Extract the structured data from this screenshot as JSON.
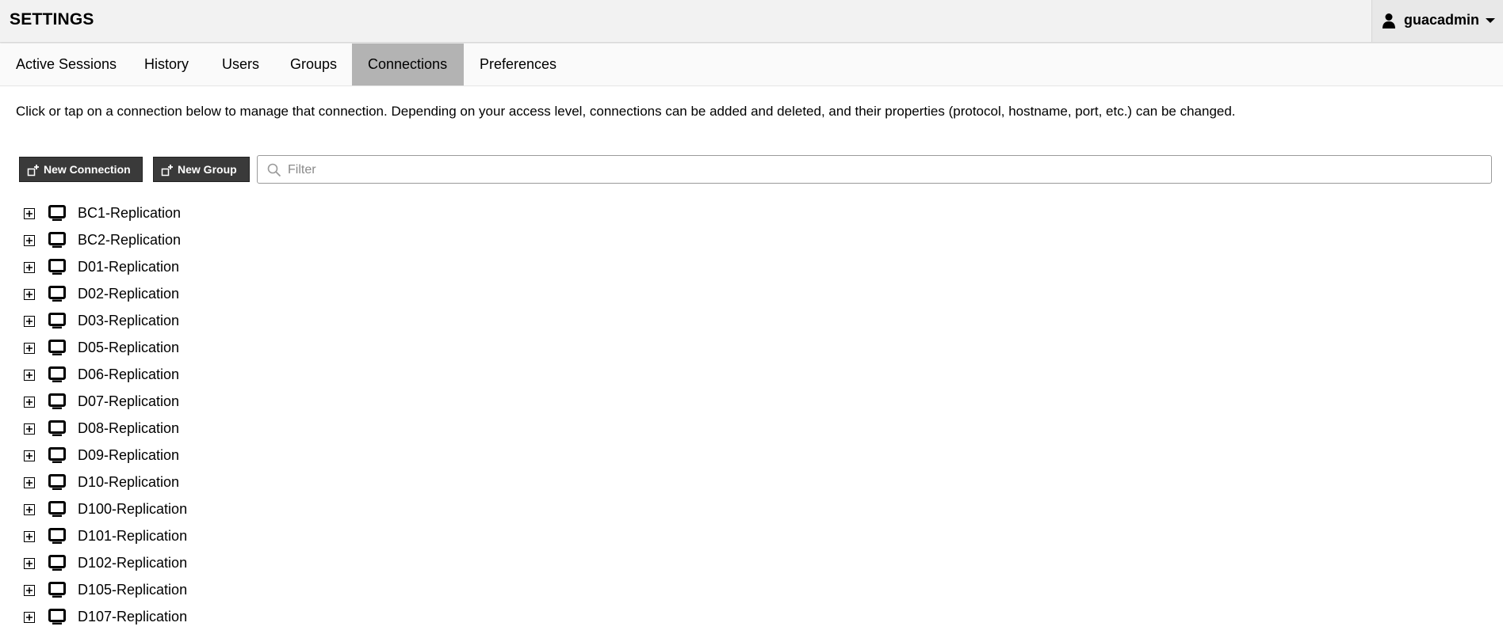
{
  "header": {
    "title": "SETTINGS",
    "user": {
      "name": "guacadmin",
      "icon": "user-icon"
    }
  },
  "tabs": [
    {
      "label": "Active Sessions",
      "active": false
    },
    {
      "label": "History",
      "active": false
    },
    {
      "label": "Users",
      "active": false
    },
    {
      "label": "Groups",
      "active": false
    },
    {
      "label": "Connections",
      "active": true
    },
    {
      "label": "Preferences",
      "active": false
    }
  ],
  "main": {
    "description": "Click or tap on a connection below to manage that connection. Depending on your access level, connections can be added and deleted, and their properties (protocol, hostname, port, etc.) can be changed.",
    "toolbar": {
      "new_connection_label": "New Connection",
      "new_group_label": "New Group",
      "filter_placeholder": "Filter",
      "filter_value": ""
    },
    "connections": [
      "BC1-Replication",
      "BC2-Replication",
      "D01-Replication",
      "D02-Replication",
      "D03-Replication",
      "D05-Replication",
      "D06-Replication",
      "D07-Replication",
      "D08-Replication",
      "D09-Replication",
      "D10-Replication",
      "D100-Replication",
      "D101-Replication",
      "D102-Replication",
      "D105-Replication",
      "D107-Replication"
    ]
  },
  "colors": {
    "header_bg": "#f2f2f2",
    "active_tab_bg": "#b3b3b3",
    "button_bg": "#3a3a3a",
    "button_text": "#ffffff"
  }
}
